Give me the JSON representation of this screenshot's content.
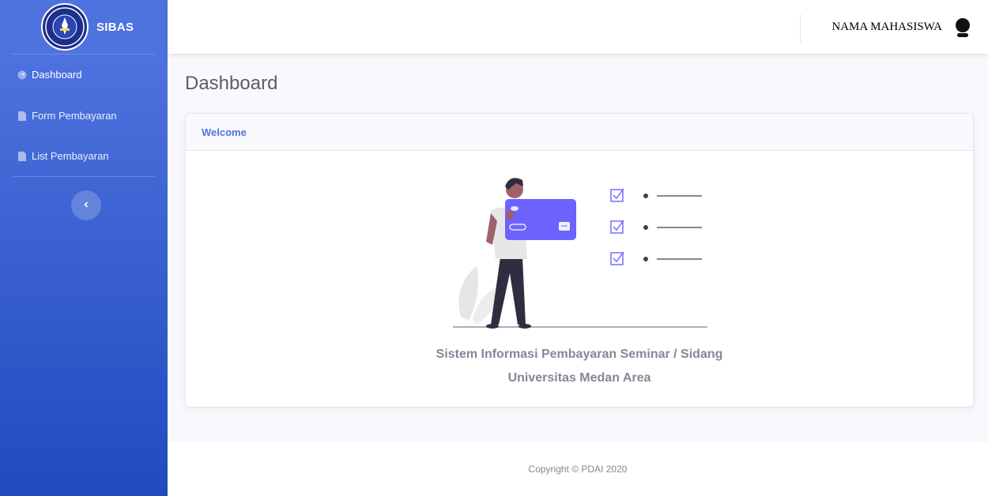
{
  "sidebar": {
    "brand": "SIBAS",
    "logo_text": "UNIVERSITAS MEDAN AREA",
    "items": [
      {
        "label": "Dashboard",
        "icon": "tachometer-icon"
      },
      {
        "label": "Form Pembayaran",
        "icon": "file-icon"
      },
      {
        "label": "List Pembayaran",
        "icon": "file-icon"
      }
    ],
    "toggle_icon": "chevron-left-icon"
  },
  "topbar": {
    "user_name": "NAMA MAHASISWA",
    "avatar_icon": "user-avatar-icon"
  },
  "page": {
    "title": "Dashboard"
  },
  "card": {
    "header": "Welcome",
    "line1": "Sistem Informasi Pembayaran Seminar / Sidang",
    "line2": "Universitas Medan Area"
  },
  "footer": {
    "copyright": "Copyright © PDAI 2020"
  },
  "colors": {
    "primary": "#4e73df",
    "primary_dark": "#224abe",
    "accent_card": "#6c63ff",
    "text_gray": "#858796"
  }
}
